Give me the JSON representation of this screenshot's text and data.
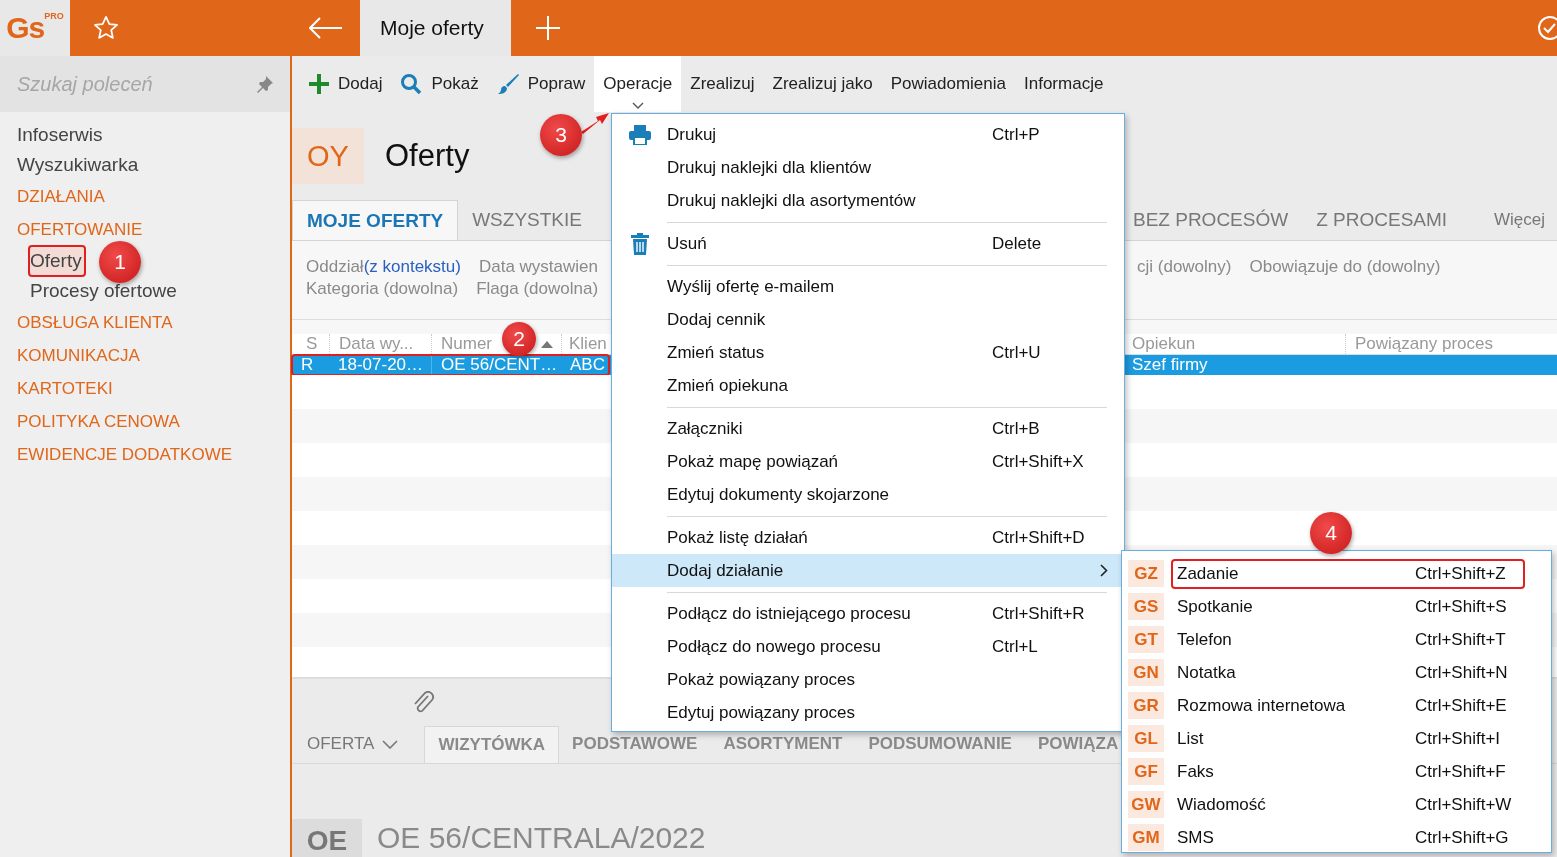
{
  "app": {
    "logo": "Gs",
    "logo_badge": "PRO"
  },
  "open_tabs": [
    {
      "label": "Moje oferty",
      "selected": true
    }
  ],
  "sidebar": {
    "search": {
      "placeholder": "Szukaj poleceń"
    },
    "items": [
      {
        "label": "Infoserwis",
        "kind": "link",
        "selected": false,
        "outlined": false
      },
      {
        "label": "Wyszukiwarka",
        "kind": "link",
        "selected": false,
        "outlined": false
      },
      {
        "label": "DZIAŁANIA",
        "kind": "section",
        "selected": false,
        "outlined": false
      },
      {
        "label": "OFERTOWANIE",
        "kind": "section",
        "selected": false,
        "outlined": false,
        "children": [
          {
            "label": "Oferty",
            "selected": true,
            "outlined": true
          },
          {
            "label": "Procesy ofertowe",
            "selected": false,
            "outlined": false
          }
        ]
      },
      {
        "label": "OBSŁUGA KLIENTA",
        "kind": "section",
        "selected": false,
        "outlined": false
      },
      {
        "label": "KOMUNIKACJA",
        "kind": "section",
        "selected": false,
        "outlined": false
      },
      {
        "label": "KARTOTEKI",
        "kind": "section",
        "selected": false,
        "outlined": false
      },
      {
        "label": "POLITYKA CENOWA",
        "kind": "section",
        "selected": false,
        "outlined": false
      },
      {
        "label": "EWIDENCJE DODATKOWE",
        "kind": "section",
        "selected": false,
        "outlined": false
      }
    ]
  },
  "toolbar": [
    {
      "label": "Dodaj",
      "open": false
    },
    {
      "label": "Pokaż",
      "open": false
    },
    {
      "label": "Popraw",
      "open": false
    },
    {
      "label": "Operacje",
      "open": true
    },
    {
      "label": "Zrealizuj",
      "open": false
    },
    {
      "label": "Zrealizuj jako",
      "open": false
    },
    {
      "label": "Powiadomienia",
      "open": false
    },
    {
      "label": "Informacje",
      "open": false
    }
  ],
  "page_header": {
    "badge": "OY",
    "title": "Oferty"
  },
  "view_tabs": {
    "left": [
      {
        "label": "MOJE OFERTY",
        "selected": true
      },
      {
        "label": "WSZYSTKIE",
        "selected": false
      }
    ],
    "right": [
      {
        "label": "BEZ PROCESÓW",
        "selected": false
      },
      {
        "label": "Z PROCESAMI",
        "selected": false
      },
      {
        "label": "Więcej",
        "selected": false
      }
    ]
  },
  "filters": {
    "left": [
      [
        {
          "text": "Oddział",
          "value": "(z kontekstu)"
        },
        {
          "text": "Data wystawien"
        }
      ],
      [
        {
          "text": "Kategoria (dowolna)"
        },
        {
          "text": "Flaga (dowolna)"
        }
      ]
    ],
    "right": [
      [
        {
          "text": "cji (dowolny)"
        },
        {
          "text": "Obowiązuje do (dowolny)"
        }
      ]
    ]
  },
  "table": {
    "columns": [
      {
        "label": "S"
      },
      {
        "label": "Data wy..."
      },
      {
        "label": "Numer"
      },
      {
        "label": "Klien"
      },
      {
        "label": "Opiekun"
      },
      {
        "label": "Powiązany proces"
      }
    ],
    "rows": [
      {
        "cells": [
          "R",
          "18-07-20…",
          "OE 56/CENT…",
          "ABC",
          "Szef firmy"
        ],
        "selected": true,
        "outlined": true
      }
    ]
  },
  "detail": {
    "section": "OFERTA",
    "tabs": [
      {
        "label": "WIZYTÓWKA",
        "selected": true
      },
      {
        "label": "PODSTAWOWE",
        "selected": false
      },
      {
        "label": "ASORTYMENT",
        "selected": false
      },
      {
        "label": "PODSUMOWANIE",
        "selected": false
      },
      {
        "label": "POWIĄZA",
        "selected": false
      }
    ],
    "badge": "OE",
    "title": "OE 56/CENTRALA/2022"
  },
  "menu": [
    {
      "kind": "item",
      "label": "Drukuj",
      "shortcut": "Ctrl+P",
      "highlighted": false
    },
    {
      "kind": "item",
      "label": "Drukuj naklejki dla klientów",
      "highlighted": false
    },
    {
      "kind": "item",
      "label": "Drukuj naklejki dla asortymentów",
      "highlighted": false
    },
    {
      "kind": "separator"
    },
    {
      "kind": "item",
      "label": "Usuń",
      "shortcut": "Delete",
      "highlighted": false
    },
    {
      "kind": "separator"
    },
    {
      "kind": "item",
      "label": "Wyślij ofertę e-mailem",
      "highlighted": false
    },
    {
      "kind": "item",
      "label": "Dodaj cennik",
      "highlighted": false
    },
    {
      "kind": "item",
      "label": "Zmień status",
      "shortcut": "Ctrl+U",
      "highlighted": false
    },
    {
      "kind": "item",
      "label": "Zmień opiekuna",
      "highlighted": false
    },
    {
      "kind": "separator"
    },
    {
      "kind": "item",
      "label": "Załączniki",
      "shortcut": "Ctrl+B",
      "highlighted": false
    },
    {
      "kind": "item",
      "label": "Pokaż mapę powiązań",
      "shortcut": "Ctrl+Shift+X",
      "highlighted": false
    },
    {
      "kind": "item",
      "label": "Edytuj dokumenty skojarzone",
      "highlighted": false
    },
    {
      "kind": "separator"
    },
    {
      "kind": "item",
      "label": "Pokaż listę działań",
      "shortcut": "Ctrl+Shift+D",
      "highlighted": false
    },
    {
      "kind": "item",
      "label": "Dodaj działanie",
      "highlighted": true,
      "submenu": true
    },
    {
      "kind": "separator"
    },
    {
      "kind": "item",
      "label": "Podłącz do istniejącego procesu",
      "shortcut": "Ctrl+Shift+R",
      "highlighted": false
    },
    {
      "kind": "item",
      "label": "Podłącz do nowego procesu",
      "shortcut": "Ctrl+L",
      "highlighted": false
    },
    {
      "kind": "item",
      "label": "Pokaż powiązany proces",
      "highlighted": false
    },
    {
      "kind": "item",
      "label": "Edytuj powiązany proces",
      "highlighted": false
    }
  ],
  "submenu": [
    {
      "code": "GZ",
      "label": "Zadanie",
      "shortcut": "Ctrl+Shift+Z",
      "outlined": true
    },
    {
      "code": "GS",
      "label": "Spotkanie",
      "shortcut": "Ctrl+Shift+S",
      "outlined": false
    },
    {
      "code": "GT",
      "label": "Telefon",
      "shortcut": "Ctrl+Shift+T",
      "outlined": false
    },
    {
      "code": "GN",
      "label": "Notatka",
      "shortcut": "Ctrl+Shift+N",
      "outlined": false
    },
    {
      "code": "GR",
      "label": "Rozmowa internetowa",
      "shortcut": "Ctrl+Shift+E",
      "outlined": false
    },
    {
      "code": "GL",
      "label": "List",
      "shortcut": "Ctrl+Shift+I",
      "outlined": false
    },
    {
      "code": "GF",
      "label": "Faks",
      "shortcut": "Ctrl+Shift+F",
      "outlined": false
    },
    {
      "code": "GW",
      "label": "Wiadomość",
      "shortcut": "Ctrl+Shift+W",
      "outlined": false
    },
    {
      "code": "GM",
      "label": "SMS",
      "shortcut": "Ctrl+Shift+G",
      "outlined": false
    }
  ],
  "callouts": [
    {
      "number": "1"
    },
    {
      "number": "2"
    },
    {
      "number": "3",
      "arrow": true
    },
    {
      "number": "4"
    }
  ]
}
